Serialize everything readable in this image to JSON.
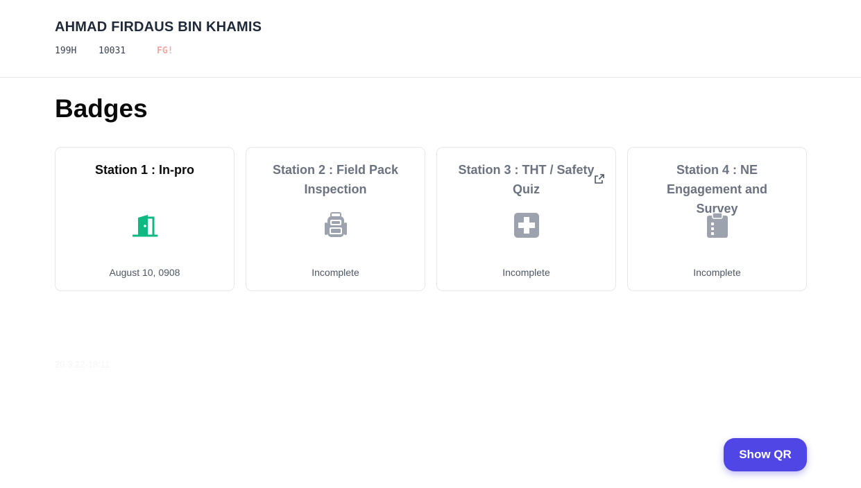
{
  "header": {
    "name": "AHMAD FIRDAUS BIN KHAMIS",
    "unit": "199H",
    "number": "10031",
    "flag": "FG!"
  },
  "section": {
    "title": "Badges"
  },
  "badges": [
    {
      "title": "Station 1 : In-pro",
      "status": "August 10, 0908",
      "icon": "door-open-icon",
      "color": "#10b981",
      "complete": true
    },
    {
      "title": "Station 2 : Field Pack Inspection",
      "status": "Incomplete",
      "icon": "backpack-icon",
      "color": "#9ca3af",
      "complete": false
    },
    {
      "title": "Station 3 : THT / Safety Quiz",
      "status": "Incomplete",
      "icon": "medical-cross-icon",
      "color": "#9ca3af",
      "complete": false,
      "has_link": true
    },
    {
      "title": "Station 4 : NE Engagement and Survey",
      "status": "Incomplete",
      "icon": "clipboard-icon",
      "color": "#9ca3af",
      "complete": false
    }
  ],
  "footer_faint": "20.3.22-18:11",
  "actions": {
    "show_qr_label": "Show QR"
  },
  "colors": {
    "accent": "#4f46e5",
    "complete": "#10b981",
    "incomplete": "#9ca3af",
    "flag": "#f3a6a6"
  }
}
